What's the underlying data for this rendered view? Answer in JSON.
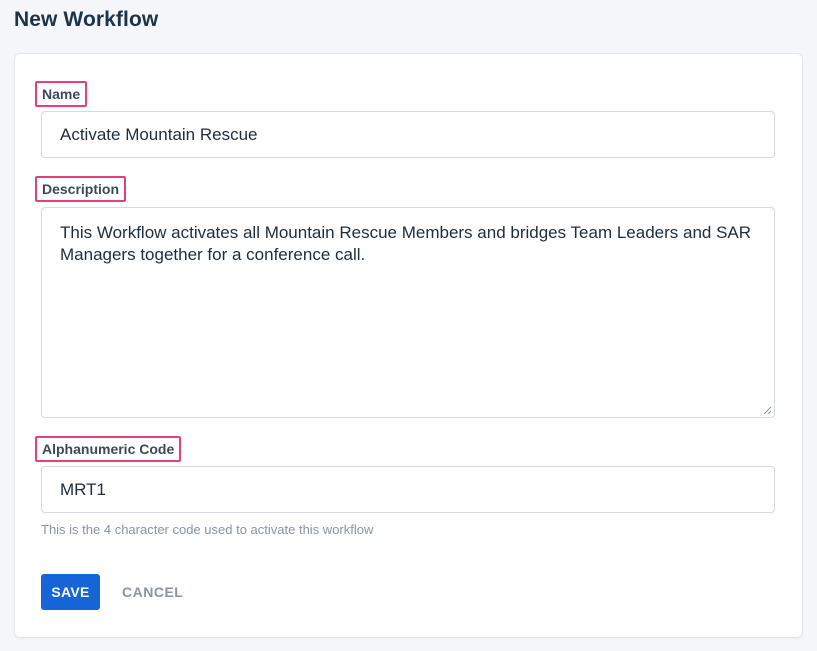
{
  "page": {
    "title": "New Workflow"
  },
  "form": {
    "name": {
      "label": "Name",
      "value": "Activate Mountain Rescue"
    },
    "description": {
      "label": "Description",
      "value": "This Workflow activates all Mountain Rescue Members and bridges Team Leaders and SAR Managers together for a conference call."
    },
    "code": {
      "label": "Alphanumeric Code",
      "value": "MRT1",
      "helper": "This is the 4 character code used to activate this workflow"
    },
    "actions": {
      "save": "SAVE",
      "cancel": "CANCEL"
    }
  },
  "colors": {
    "primary": "#1565d8",
    "highlight": "#e83e7a",
    "title": "#1d3348",
    "muted": "#8a95a1"
  }
}
